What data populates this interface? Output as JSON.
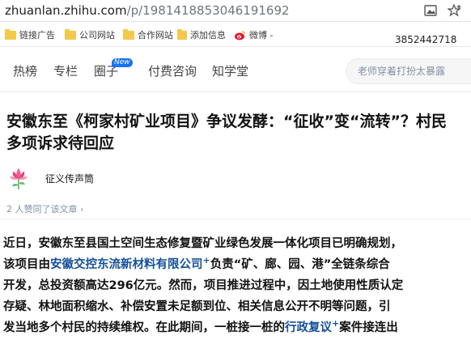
{
  "browser": {
    "url_domain": "zhuanlan.zhihu.com",
    "url_path": "/p/1981418853046191692",
    "bookmarks": [
      {
        "label": "链接广告"
      },
      {
        "label": "公司网站"
      },
      {
        "label": "合作网站"
      },
      {
        "label": "添加信息"
      },
      {
        "label": "微博 -"
      }
    ],
    "phone": "3852442718"
  },
  "nav": {
    "tabs": [
      "热榜",
      "专栏",
      "圈子",
      "付费咨询",
      "知学堂"
    ],
    "new_badge": "New",
    "search_placeholder": "老师穿着打扮太暴露"
  },
  "article": {
    "title": "安徽东至《柯家村矿业项目》争议发酵：“征收”变“流转”？村民多项诉求待回应",
    "author": "征义传声筒",
    "likes": "2 人赞同了该文章 ›",
    "paragraph": {
      "line1": "近日，安徽东至县国土空间生态修复暨矿业绿色发展一体化项目已明确规划，",
      "line2_pre": "该项目由",
      "line2_link": "安徽交控东流新材料有限公司",
      "line2_sup": "+",
      "line2_post": "负责“矿、廊、园、港”全链条综合",
      "line3": "开发，总投资额高达296亿元。然而，项目推进过程中，因土地使用性质认定",
      "line4": "存疑、林地面积缩水、补偿安置未足额到位、相关信息公开不明等问题，引",
      "line5_pre": "发当地多个村民的持续维权。在此期间，一桩接一桩的",
      "line5_link": "行政复议",
      "line5_sup": "+",
      "line5_post": "案件接连出"
    }
  },
  "colors": {
    "link": "#175199",
    "accent": "#1772f6",
    "folder": "#f4c84a"
  }
}
